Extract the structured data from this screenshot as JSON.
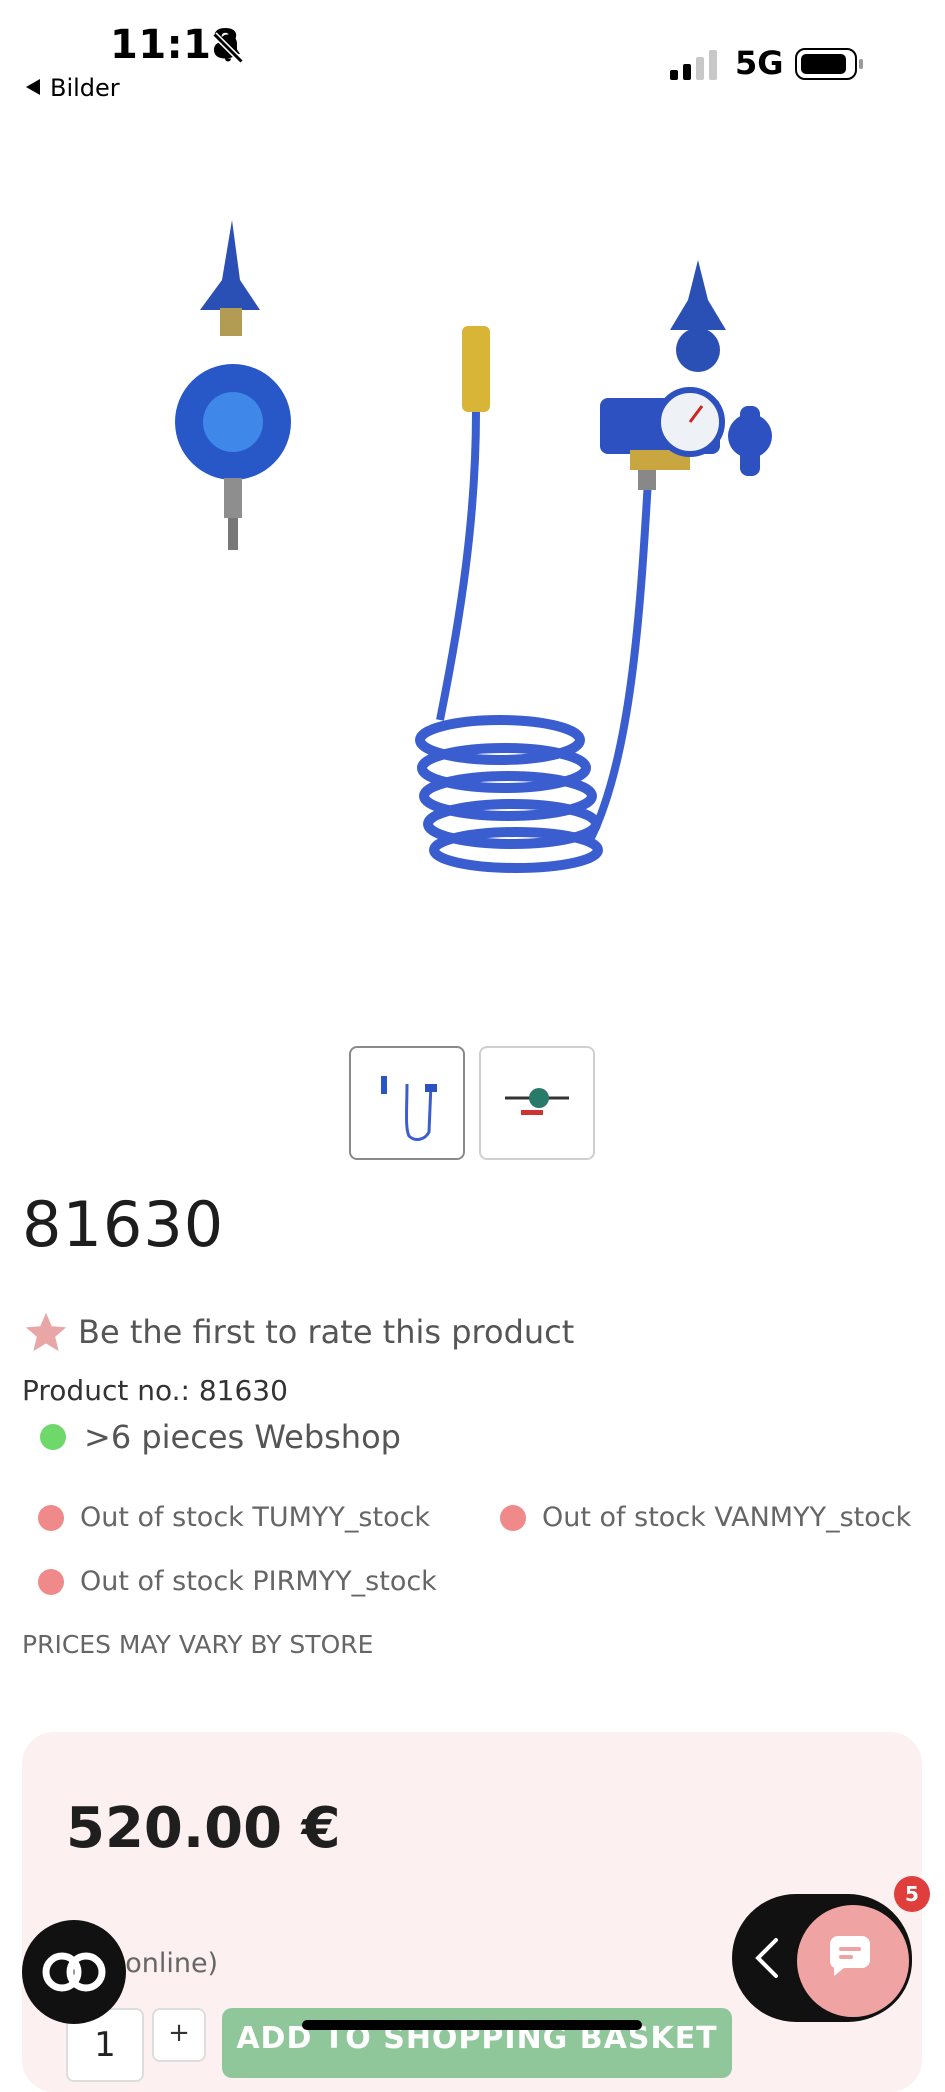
{
  "status_bar": {
    "time": "11:18",
    "network": "5G",
    "back_label": "Bilder"
  },
  "product": {
    "title": "81630",
    "rating_text": "Be the first to rate this product",
    "product_no": "Product no.: 81630",
    "webshop_stock": ">6 pieces Webshop",
    "stores": [
      {
        "label": "Out of stock TUMYY_stock",
        "status": "out"
      },
      {
        "label": "Out of stock VANMYY_stock",
        "status": "out"
      },
      {
        "label": "Out of stock PIRMYY_stock",
        "status": "out"
      }
    ],
    "price_notice": "PRICES MAY VARY BY STORE",
    "price": "520.00 €",
    "online_note": "e online)"
  },
  "purchase": {
    "quantity": "1",
    "plus_label": "+",
    "add_button": "ADD TO SHOPPING BASKET"
  },
  "chat": {
    "badge_count": "5"
  },
  "colors": {
    "accent_green": "#8fc79a",
    "in_stock": "#6fd86b",
    "out_of_stock": "#f08a8a",
    "price_panel": "#fdf0f0",
    "chat_pink": "#efa3a3",
    "badge_red": "#e03d3d",
    "star": "#e8a6a6"
  },
  "icons": {
    "bell": "bell-muted-icon",
    "back": "back-triangle-icon",
    "signal": "signal-icon",
    "battery": "battery-icon",
    "star": "star-icon",
    "accessibility": "accessibility-icon",
    "chat": "chat-icon",
    "chevron": "chevron-left-icon"
  }
}
